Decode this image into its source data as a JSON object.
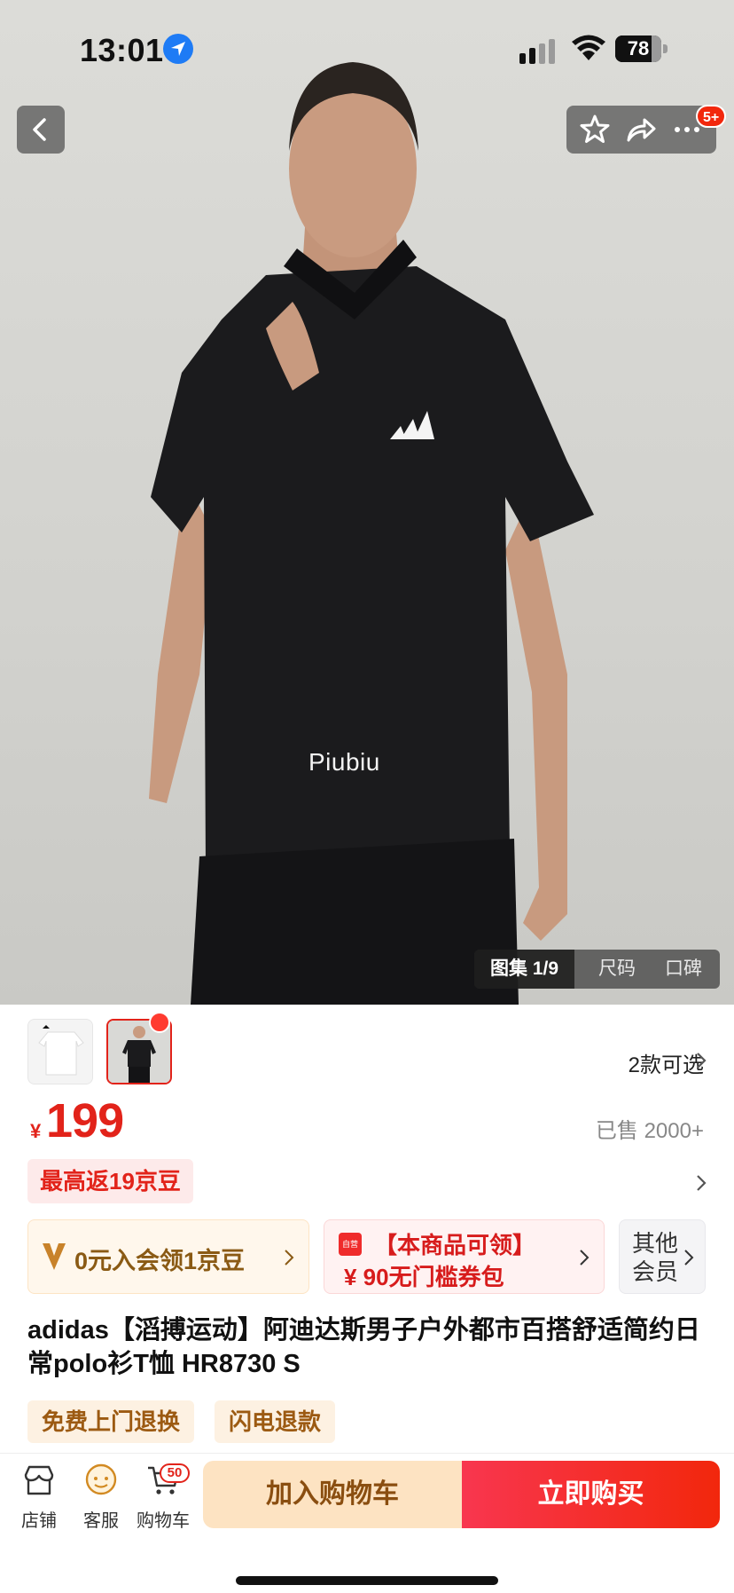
{
  "status_bar": {
    "time": "13:01",
    "battery": "78",
    "battery_level": 0.78
  },
  "nav": {
    "badge": "5+"
  },
  "hero": {
    "watermark": "Piubiu"
  },
  "gallery_tabs": [
    {
      "label": "图集 1/9",
      "active": true
    },
    {
      "label": "尺码",
      "active": false
    },
    {
      "label": "口碑",
      "active": false
    }
  ],
  "variants_label": "2款可选",
  "price": {
    "currency": "¥",
    "amount": "199",
    "sold": "已售 2000+"
  },
  "cashback": "最高返19京豆",
  "promos": {
    "join": "0元入会领1京豆",
    "coupon_tag": "自营",
    "coupon_line1": "【本商品可领】",
    "coupon_line2": "¥ 90无门槛券包",
    "other_members": "其他会员"
  },
  "title": "adidas【滔搏运动】阿迪达斯男子户外都市百搭舒适简约日常polo衫T恤 HR8730 S",
  "tags": [
    "免费上门退换",
    "闪电退款"
  ],
  "bottom_bar": {
    "store": "店铺",
    "service": "客服",
    "cart": "购物车",
    "cart_count": "50",
    "add_to_cart": "加入购物车",
    "buy_now": "立即购买"
  },
  "colors": {
    "accent": "#e2231a",
    "buy_gradient_start": "#f8364f",
    "buy_gradient_end": "#f2270c",
    "add_cart_bg": "#fde3c2"
  }
}
